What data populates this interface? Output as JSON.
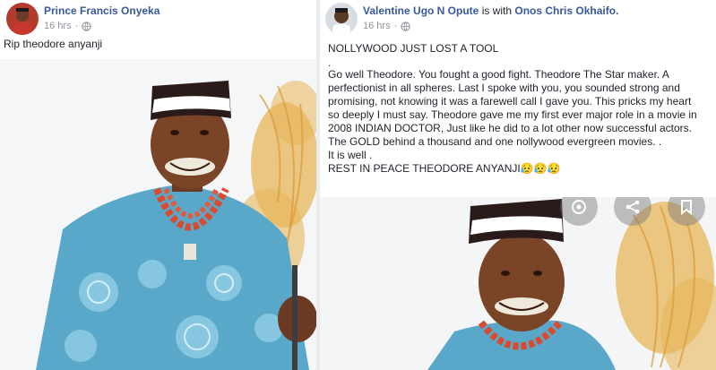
{
  "left_post": {
    "author": "Prince Francis Onyeka",
    "time": "16 hrs",
    "privacy_icon": "globe-icon",
    "text": "Rip theodore anyanji"
  },
  "right_post": {
    "author": "Valentine Ugo N Opute",
    "with_text": "is with",
    "with_name": "Onos Chris Okhaifo.",
    "time": "16 hrs",
    "privacy_icon": "globe-icon",
    "lines": [
      "NOLLYWOOD JUST LOST A TOOL",
      ".",
      "Go well Theodore. You fought a good fight. Theodore The Star maker. A",
      "perfectionist in all spheres. Last I spoke with you, you sounded strong and",
      "promising, not knowing it was a farewell call I gave you. This pricks my heart",
      "so deeply I must say. Theodore gave me my first ever major role in a movie in",
      "2008 INDIAN DOCTOR, Just like he did to a lot other now successful actors.",
      "The GOLD behind a thousand and one nollywood evergreen movies. .",
      "It is well .",
      "REST IN PEACE THEODORE ANYANJI😥😥😥"
    ],
    "overlay_icons": [
      "lens-icon",
      "share-icon",
      "bookmark-icon"
    ]
  },
  "colors": {
    "link": "#385898",
    "text": "#1d2129",
    "muted": "#90949c",
    "robe": "#5aa8c9",
    "cap": "#2a1a1a"
  }
}
